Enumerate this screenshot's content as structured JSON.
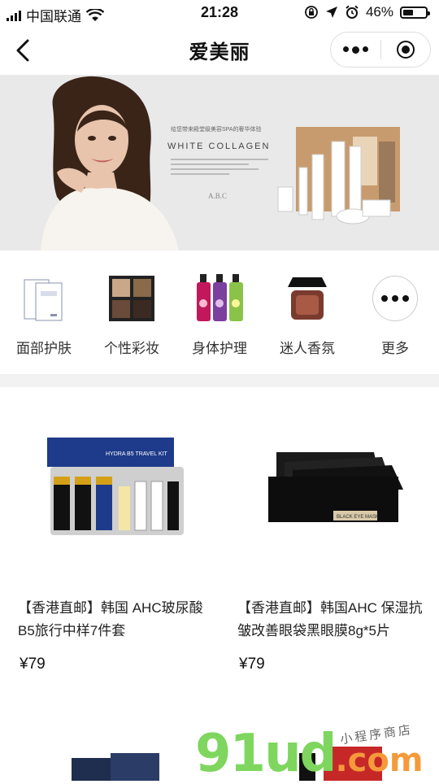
{
  "status_bar": {
    "carrier": "中国联通",
    "time": "21:28",
    "battery_text": "46%",
    "battery_level": 0.46
  },
  "nav": {
    "title": "爱美丽"
  },
  "banner": {
    "tagline": "给您带来殿堂级美容SPA的奢华体验",
    "headline": "WHITE COLLAGEN",
    "brand": "A.B.C",
    "slide_count": 2
  },
  "categories": [
    {
      "label": "面部护肤",
      "icon": "face-mask-icon"
    },
    {
      "label": "个性彩妆",
      "icon": "eyeshadow-palette-icon"
    },
    {
      "label": "身体护理",
      "icon": "body-wash-bottles-icon"
    },
    {
      "label": "迷人香氛",
      "icon": "perfume-icon"
    },
    {
      "label": "更多",
      "icon": "more-icon"
    }
  ],
  "products": [
    {
      "name": "【香港直邮】韩国 AHC玻尿酸B5旅行中样7件套",
      "price": "¥79",
      "box_text": "HYDRA B5 TRAVEL KIT"
    },
    {
      "name": "【香港直邮】韩国AHC 保湿抗皱改善眼袋黑眼膜8g*5片",
      "price": "¥79",
      "box_text": "BLACK EYE MASK"
    }
  ],
  "watermark": {
    "main": "91ud",
    "suffix": ".com",
    "script": "小程序商店"
  }
}
